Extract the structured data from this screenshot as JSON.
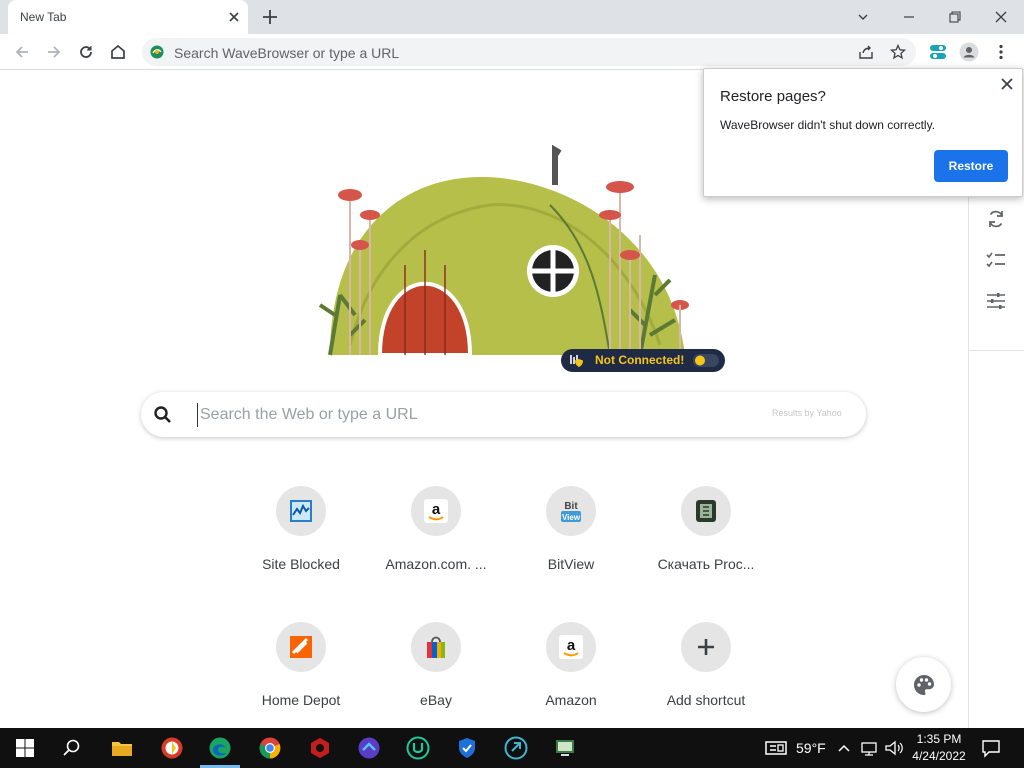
{
  "tab": {
    "title": "New Tab"
  },
  "omnibox": {
    "placeholder": "Search WaveBrowser or type a URL"
  },
  "popup": {
    "title": "Restore pages?",
    "message": "WaveBrowser didn't shut down correctly.",
    "button": "Restore"
  },
  "vpn": {
    "status": "Not Connected!"
  },
  "search": {
    "placeholder": "Search the Web or type a URL",
    "provider": "Results by Yahoo"
  },
  "shortcuts": [
    {
      "label": "Site Blocked"
    },
    {
      "label": "Amazon.com. ..."
    },
    {
      "label": "BitView"
    },
    {
      "label": "Скачать Proc..."
    },
    {
      "label": "Home Depot"
    },
    {
      "label": "eBay"
    },
    {
      "label": "Amazon"
    },
    {
      "label": "Add shortcut"
    }
  ],
  "taskbar": {
    "temperature": "59°F",
    "time": "1:35 PM",
    "date": "4/24/2022"
  },
  "colors": {
    "accent": "#1a73e8",
    "vpn_bg": "#1f2a44",
    "vpn_text": "#f5c518"
  }
}
